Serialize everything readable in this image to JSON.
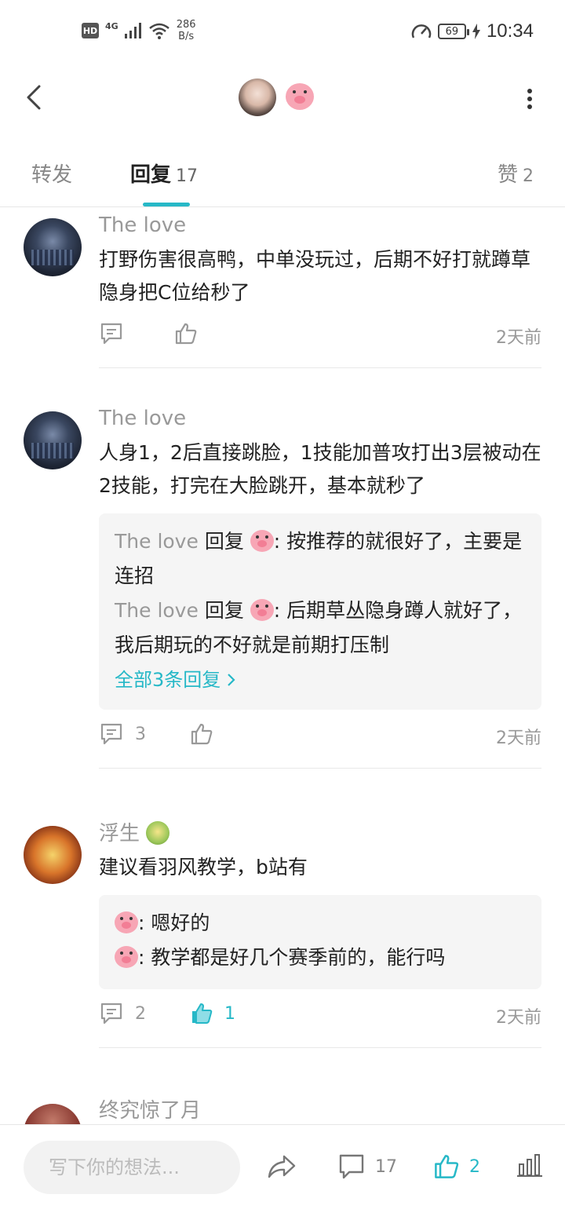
{
  "status_bar": {
    "hd": "HD",
    "network": "4G",
    "speed_value": "286",
    "speed_unit": "B/s",
    "battery": "69",
    "time": "10:34"
  },
  "tabs": {
    "forward": "转发",
    "reply": "回复",
    "reply_count": "17",
    "like": "赞",
    "like_count": "2"
  },
  "comments": [
    {
      "name": "The love",
      "text": "打野伤害很高鸭，中单没玩过，后期不好打就蹲草隐身把C位给秒了",
      "comment_count": "",
      "like_count": "",
      "time": "2天前"
    },
    {
      "name": "The love",
      "text": "人身1，2后直接跳脸，1技能加普攻打出3层被动在2技能，打完在大脸跳开，基本就秒了",
      "replies": [
        {
          "who": "The love",
          "mid": " 回复 ",
          "text": ": 按推荐的就很好了，主要是连招"
        },
        {
          "who": "The love",
          "mid": " 回复 ",
          "text": ": 后期草丛隐身蹲人就好了，我后期玩的不好就是前期打压制"
        }
      ],
      "all_replies": "全部3条回复",
      "comment_count": "3",
      "like_count": "",
      "time": "2天前"
    },
    {
      "name": "浮生",
      "text": "建议看羽风教学，b站有",
      "replies": [
        {
          "text": ": 嗯好的"
        },
        {
          "text": ": 教学都是好几个赛季前的，能行吗"
        }
      ],
      "comment_count": "2",
      "like_count": "1",
      "time": "2天前"
    },
    {
      "name": "终究惊了月"
    }
  ],
  "bottom_bar": {
    "placeholder": "写下你的想法...",
    "comment_count": "17",
    "like_count": "2"
  },
  "colors": {
    "accent": "#26b8c7"
  }
}
